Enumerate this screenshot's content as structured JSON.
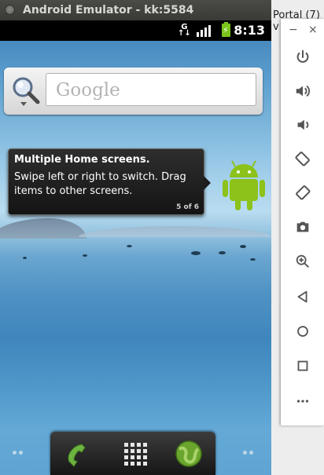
{
  "window": {
    "title": "Android Emulator - kk:5584"
  },
  "background_window": {
    "label": "Portal (7) v"
  },
  "status_bar": {
    "time": "8:13",
    "network": "G"
  },
  "search_widget": {
    "placeholder": "Google"
  },
  "tooltip": {
    "title": "Multiple Home screens.",
    "body": "Swipe left or right to switch. Drag items to other screens.",
    "counter": "5 of 6"
  },
  "dock": {
    "items": [
      "phone-icon",
      "app-drawer-icon",
      "browser-icon"
    ]
  },
  "emulator_panel": {
    "minimize": "−",
    "close": "×",
    "controls": [
      "power",
      "volume-up",
      "volume-down",
      "rotate-left",
      "rotate-right",
      "screenshot",
      "zoom",
      "back",
      "home",
      "overview",
      "more"
    ]
  },
  "colors": {
    "accent_green": "#7ac51c",
    "tooltip_bg": "#1d1d1d"
  }
}
